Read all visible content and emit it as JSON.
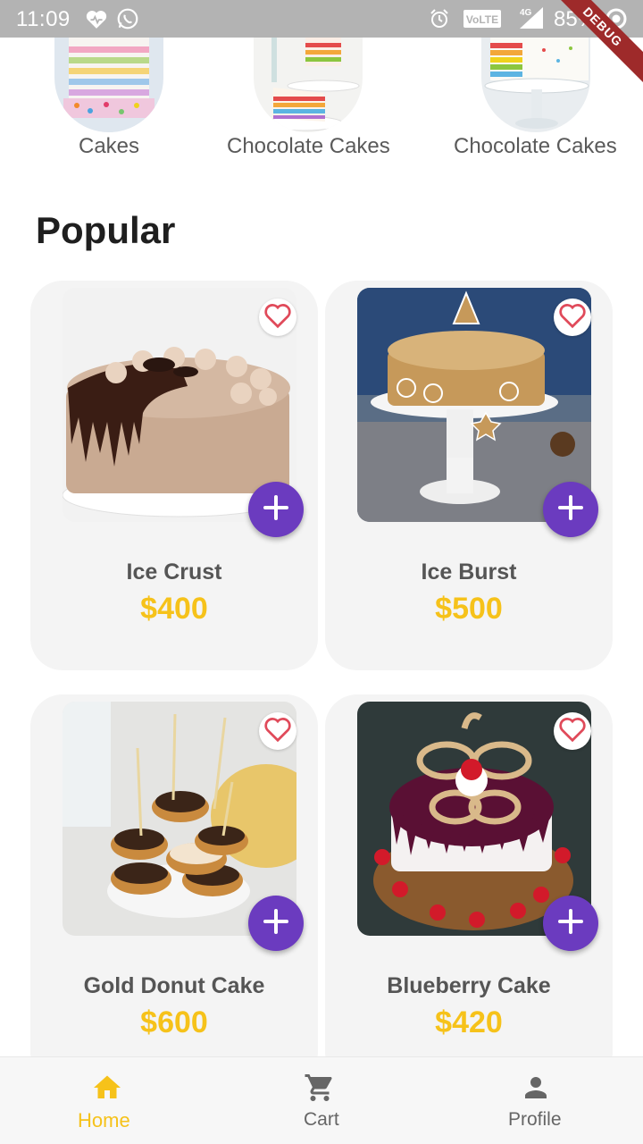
{
  "status_bar": {
    "time": "11:09",
    "battery": "85%",
    "network": "4G",
    "volte": "VoLTE",
    "debug": "DEBUG",
    "icons": [
      "heart-icon",
      "whatsapp-icon",
      "alarm-icon",
      "volte-icon",
      "signal-icon",
      "battery-icon"
    ]
  },
  "categories": [
    {
      "label": "Cakes",
      "image": "rainbow-sprinkle-cake"
    },
    {
      "label": "Chocolate Cakes",
      "image": "rainbow-cake-slices"
    },
    {
      "label": "Chocolate Cakes",
      "image": "rainbow-cake-on-stand"
    }
  ],
  "popular": {
    "title": "Popular",
    "items": [
      {
        "name": "Ice Crust",
        "price": "$400",
        "image": "chocolate-drip-cake"
      },
      {
        "name": "Ice Burst",
        "price": "$500",
        "image": "gingerbread-christmas-cake"
      },
      {
        "name": "Gold Donut Cake",
        "price": "$600",
        "image": "donut-tower-with-candles"
      },
      {
        "name": "Blueberry Cake",
        "price": "$420",
        "image": "blueberry-cherry-cake"
      }
    ]
  },
  "bottom_nav": {
    "items": [
      {
        "label": "Home",
        "icon": "home-icon",
        "active": true
      },
      {
        "label": "Cart",
        "icon": "cart-icon",
        "active": false
      },
      {
        "label": "Profile",
        "icon": "profile-icon",
        "active": false
      }
    ]
  },
  "colors": {
    "accent": "#f6c21a",
    "add_button": "#6b3bbf",
    "heart": "#e04a5a",
    "card_bg": "#f4f4f4",
    "inactive_nav": "#666666"
  }
}
